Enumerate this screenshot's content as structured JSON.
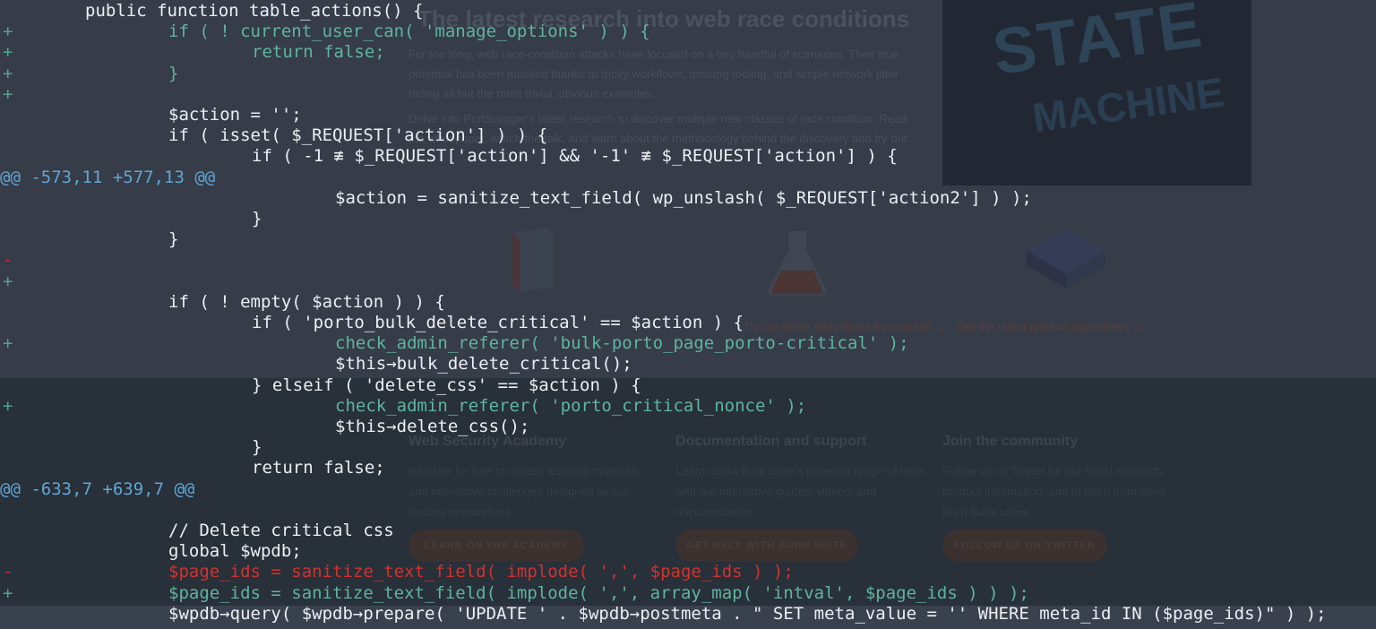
{
  "background_page": {
    "title": "The latest research into web race conditions",
    "intro_paragraph": "For too long, web race-condition attacks have focused on a tiny handful of scenarios. Their true potential has been masked thanks to tricky workflows, missing tooling, and simple network jitter hiding all but the most trivial, obvious examples.",
    "second_paragraph": "Delve into PortSwigger's latest research to discover multiple new classes of race condition. Read the whitepaper, watch the talk, and learn about the methodology behind the discovery and try out",
    "poster": {
      "line1": "STATE",
      "line2": "MACHINE"
    },
    "feature_links": [
      "Try out these techniques for yourself →",
      "Get the latest product capabilities →"
    ],
    "columns": [
      {
        "heading": "Web Security Academy",
        "text": "Register for free to access learning materials and interactive challenges designed by our leading researchers.",
        "button": "LEARN ON THE ACADEMY"
      },
      {
        "heading": "Documentation and support",
        "text": "Learn about Burp Suite's powerful range of tools with our interactive guides, videos, and documentation.",
        "button": "GET HELP WITH BURP SUITE"
      },
      {
        "heading": "Join the community",
        "text": "Follow us on Twitter for our latest research, product information, and to learn from other Burp Suite users.",
        "button": "FOLLOW US ON TWITTER"
      }
    ]
  },
  "colors": {
    "added": "#5fb59e",
    "removed": "#d2322e",
    "hunk_header": "#5ea7d6",
    "context": "#eceff4"
  },
  "diff_lines": [
    {
      "type": "context",
      "marker": "",
      "indent": 1,
      "text": "public function table_actions() {"
    },
    {
      "type": "added",
      "marker": "+",
      "indent": 2,
      "text": "if ( ! current_user_can( 'manage_options' ) ) {"
    },
    {
      "type": "added",
      "marker": "+",
      "indent": 3,
      "text": "return false;"
    },
    {
      "type": "added",
      "marker": "+",
      "indent": 2,
      "text": "}"
    },
    {
      "type": "added",
      "marker": "+",
      "indent": 0,
      "text": ""
    },
    {
      "type": "context",
      "marker": "",
      "indent": 2,
      "text": "$action = '';"
    },
    {
      "type": "context",
      "marker": "",
      "indent": 2,
      "text": "if ( isset( $_REQUEST['action'] ) ) {"
    },
    {
      "type": "context",
      "marker": "",
      "indent": 3,
      "text": "if ( -1 ≢ $_REQUEST['action'] && '-1' ≢ $_REQUEST['action'] ) {"
    },
    {
      "type": "hunk",
      "marker": "",
      "indent": 0,
      "text": "@@ -573,11 +577,13 @@"
    },
    {
      "type": "context",
      "marker": "",
      "indent": 4,
      "text": "$action = sanitize_text_field( wp_unslash( $_REQUEST['action2'] ) );"
    },
    {
      "type": "context",
      "marker": "",
      "indent": 3,
      "text": "}"
    },
    {
      "type": "context",
      "marker": "",
      "indent": 2,
      "text": "}"
    },
    {
      "type": "removed",
      "marker": "-",
      "indent": 0,
      "text": ""
    },
    {
      "type": "added",
      "marker": "+",
      "indent": 0,
      "text": ""
    },
    {
      "type": "context",
      "marker": "",
      "indent": 2,
      "text": "if ( ! empty( $action ) ) {"
    },
    {
      "type": "context",
      "marker": "",
      "indent": 3,
      "text": "if ( 'porto_bulk_delete_critical' == $action ) {"
    },
    {
      "type": "added",
      "marker": "+",
      "indent": 4,
      "text": "check_admin_referer( 'bulk-porto_page_porto-critical' );"
    },
    {
      "type": "context",
      "marker": "",
      "indent": 4,
      "text": "$this→bulk_delete_critical();"
    },
    {
      "type": "context",
      "marker": "",
      "indent": 3,
      "text": "} elseif ( 'delete_css' == $action ) {"
    },
    {
      "type": "added",
      "marker": "+",
      "indent": 4,
      "text": "check_admin_referer( 'porto_critical_nonce' );"
    },
    {
      "type": "context",
      "marker": "",
      "indent": 4,
      "text": "$this→delete_css();"
    },
    {
      "type": "context",
      "marker": "",
      "indent": 3,
      "text": "}"
    },
    {
      "type": "context",
      "marker": "",
      "indent": 3,
      "text": "return false;"
    },
    {
      "type": "hunk",
      "marker": "",
      "indent": 0,
      "text": "@@ -633,7 +639,7 @@"
    },
    {
      "type": "context",
      "marker": "",
      "indent": 0,
      "text": ""
    },
    {
      "type": "context",
      "marker": "",
      "indent": 2,
      "text": "// Delete critical css"
    },
    {
      "type": "context",
      "marker": "",
      "indent": 2,
      "text": "global $wpdb;"
    },
    {
      "type": "removed",
      "marker": "-",
      "indent": 2,
      "text": "$page_ids = sanitize_text_field( implode( ',', $page_ids ) );"
    },
    {
      "type": "added",
      "marker": "+",
      "indent": 2,
      "text": "$page_ids = sanitize_text_field( implode( ',', array_map( 'intval', $page_ids ) ) );"
    },
    {
      "type": "context",
      "marker": "",
      "indent": 2,
      "text": "$wpdb→query( $wpdb→prepare( 'UPDATE ' . $wpdb→postmeta . \" SET meta_value = '' WHERE meta_id IN ($page_ids)\" ) );"
    }
  ]
}
